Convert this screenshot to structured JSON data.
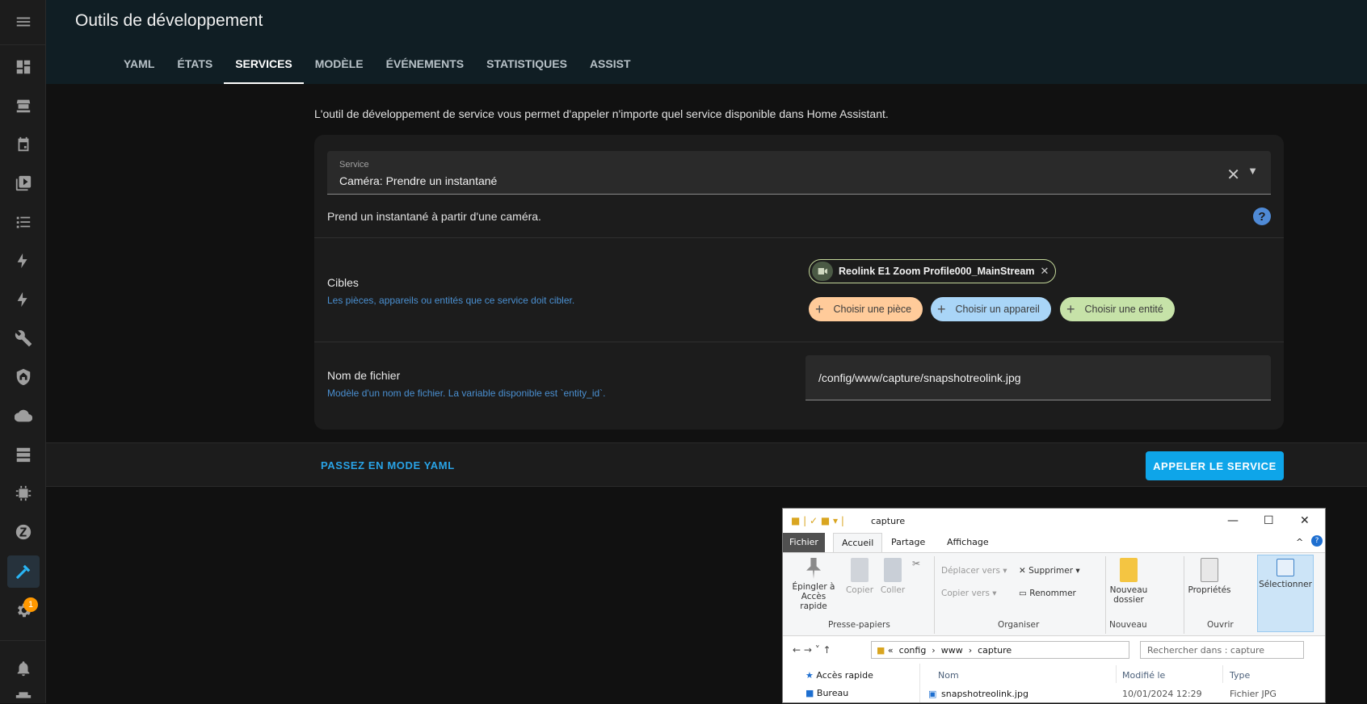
{
  "header": {
    "title": "Outils de développement",
    "tabs": [
      "YAML",
      "ÉTATS",
      "SERVICES",
      "MODÈLE",
      "ÉVÉNEMENTS",
      "STATISTIQUES",
      "ASSIST"
    ],
    "active_tab": "SERVICES"
  },
  "sidebar": {
    "items": [
      "menu-icon",
      "overview-icon",
      "hacs-icon",
      "calendar-icon",
      "media-icon",
      "todo-icon",
      "energy-icon",
      "energy2-icon",
      "wrench-icon",
      "shield-home-icon",
      "cloud-icon",
      "server-icon",
      "chip-icon",
      "zwave-icon",
      "hammer-icon",
      "settings-icon",
      "bell-icon"
    ],
    "settings_badge": "1",
    "accent": "#29b6f6"
  },
  "intro": "L'outil de développement de service vous permet d'appeler n'importe quel service disponible dans Home Assistant.",
  "service": {
    "label": "Service",
    "value": "Caméra: Prendre un instantané",
    "description": "Prend un instantané à partir d'une caméra."
  },
  "targets": {
    "title": "Cibles",
    "subtitle": "Les pièces, appareils ou entités que ce service doit cibler.",
    "entity": "Reolink E1 Zoom Profile000_MainStream",
    "choose_room": "Choisir une pièce",
    "choose_device": "Choisir un appareil",
    "choose_entity": "Choisir une entité"
  },
  "filename": {
    "title": "Nom de fichier",
    "subtitle": "Modèle d'un nom de fichier. La variable disponible est `entity_id`.",
    "value": "/config/www/capture/snapshotreolink.jpg"
  },
  "footer": {
    "yaml_mode": "PASSEZ EN MODE YAML",
    "call_service": "APPELER LE SERVICE"
  },
  "explorer": {
    "title": "capture",
    "tabs": [
      "Fichier",
      "Accueil",
      "Partage",
      "Affichage"
    ],
    "ribbon": {
      "pin": "Épingler à Accès rapide",
      "copy": "Copier",
      "paste": "Coller",
      "move_to": "Déplacer vers",
      "copy_to": "Copier vers",
      "delete": "Supprimer",
      "rename": "Renommer",
      "new_folder": "Nouveau dossier",
      "properties": "Propriétés",
      "select": "Sélectionner",
      "groups": [
        "Presse-papiers",
        "Organiser",
        "Nouveau",
        "Ouvrir"
      ]
    },
    "address": [
      "config",
      "www",
      "capture"
    ],
    "search_placeholder": "Rechercher dans : capture",
    "nav": [
      "Accès rapide",
      "Bureau"
    ],
    "columns": [
      "Nom",
      "Modifié le",
      "Type"
    ],
    "files": [
      {
        "name": "snapshotreolink.jpg",
        "modified": "10/01/2024 12:29",
        "type": "Fichier JPG"
      }
    ]
  }
}
